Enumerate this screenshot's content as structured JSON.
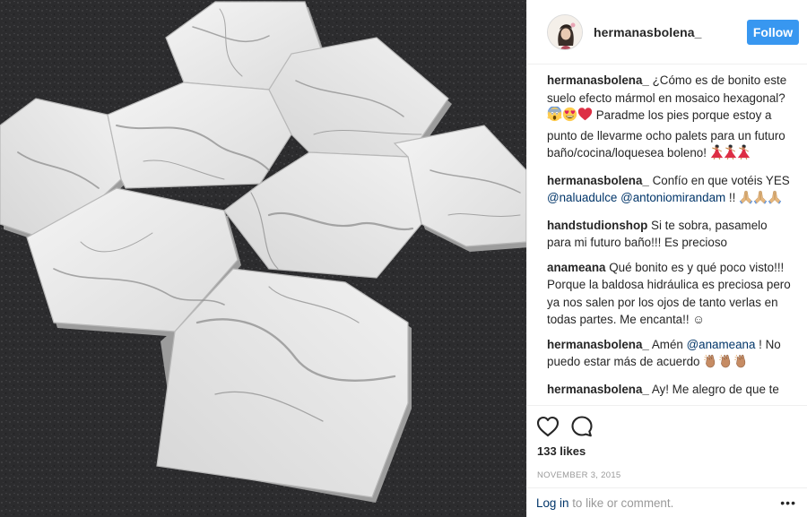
{
  "post": {
    "author": "hermanasbolena_",
    "follow_label": "Follow",
    "likes": "133 likes",
    "date": "NOVEMBER 3, 2015"
  },
  "comments": [
    {
      "author": "hermanasbolena_",
      "parts": [
        {
          "type": "text",
          "value": " ¿Cómo es de bonito este suelo efecto mármol en mosaico hexagonal? "
        },
        {
          "type": "emoji",
          "name": "scream-emoji"
        },
        {
          "type": "emoji",
          "name": "heart-eyes-emoji"
        },
        {
          "type": "emoji",
          "name": "red-heart-emoji"
        },
        {
          "type": "text",
          "value": " Paradme los pies porque estoy a punto de llevarme ocho palets para un futuro baño/cocina/loquesea boleno! "
        },
        {
          "type": "emoji",
          "name": "dancer-emoji"
        },
        {
          "type": "emoji",
          "name": "dancer-emoji"
        },
        {
          "type": "emoji",
          "name": "dancer-emoji"
        }
      ]
    },
    {
      "author": "hermanasbolena_",
      "parts": [
        {
          "type": "text",
          "value": " Confío en que votéis YES "
        },
        {
          "type": "mention",
          "value": "@naluadulce"
        },
        {
          "type": "text",
          "value": " "
        },
        {
          "type": "mention",
          "value": "@antoniomirandam"
        },
        {
          "type": "text",
          "value": " !! "
        },
        {
          "type": "emoji",
          "name": "praying-hands-emoji"
        },
        {
          "type": "emoji",
          "name": "praying-hands-emoji"
        },
        {
          "type": "emoji",
          "name": "praying-hands-emoji"
        }
      ]
    },
    {
      "author": "handstudionshop",
      "parts": [
        {
          "type": "text",
          "value": " Si te sobra, pasamelo para mi futuro baño!!! Es precioso"
        }
      ]
    },
    {
      "author": "anameana",
      "parts": [
        {
          "type": "text",
          "value": " Qué bonito es y qué poco visto!!! Porque la baldosa hidráulica es preciosa pero ya nos salen por los ojos de tanto verlas en todas partes. Me encanta!! "
        },
        {
          "type": "text",
          "value": "☺"
        }
      ]
    },
    {
      "author": "hermanasbolena_",
      "parts": [
        {
          "type": "text",
          "value": " Amén "
        },
        {
          "type": "mention",
          "value": "@anameana"
        },
        {
          "type": "text",
          "value": " ! No puedo estar más de acuerdo "
        },
        {
          "type": "emoji",
          "name": "clapping-hands-emoji"
        },
        {
          "type": "emoji",
          "name": "clapping-hands-emoji"
        },
        {
          "type": "emoji",
          "name": "clapping-hands-emoji"
        }
      ]
    },
    {
      "author": "hermanasbolena_",
      "parts": [
        {
          "type": "text",
          "value": " Ay! Me alegro de que te"
        }
      ]
    }
  ],
  "footer": {
    "login_link": "Log in",
    "login_rest": " to like or comment.",
    "more_label": "•••"
  },
  "icons": {
    "like": "heart-outline-icon",
    "comment": "speech-bubble-icon",
    "more": "more-options-icon"
  },
  "colors": {
    "accent": "#3897f0",
    "link": "#003569",
    "muted": "#999999",
    "text": "#262626",
    "border": "#efefef"
  }
}
